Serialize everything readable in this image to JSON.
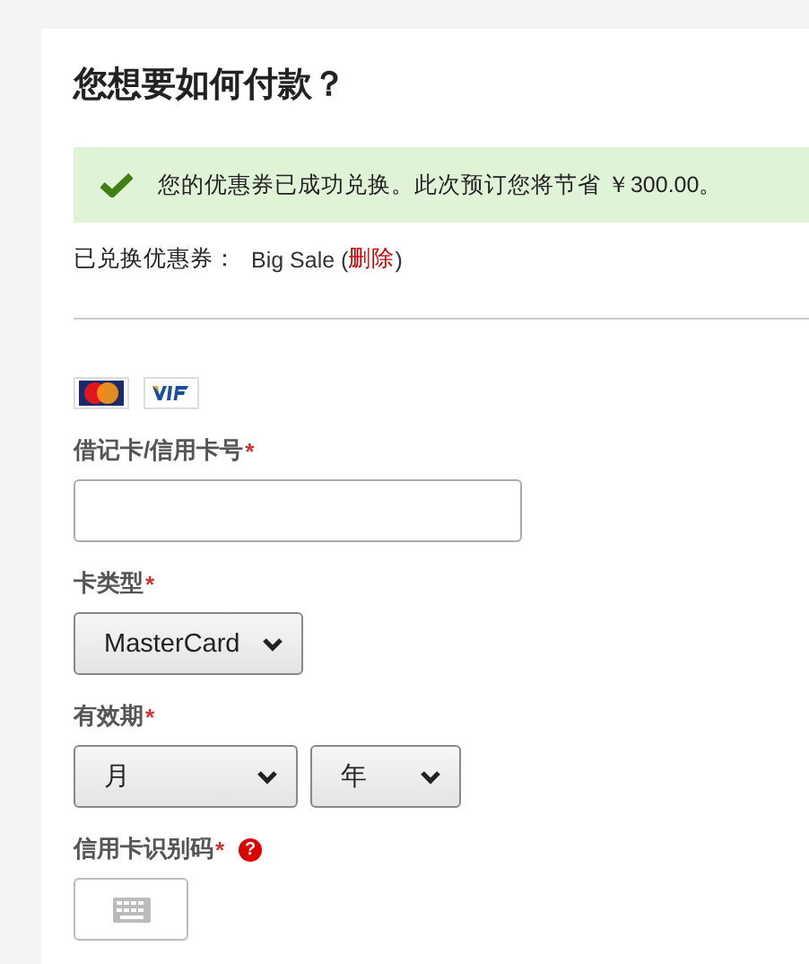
{
  "title": "您想要如何付款？",
  "success_banner": {
    "message": "您的优惠券已成功兑换。此次预订您将节省 ￥300.00。"
  },
  "coupon": {
    "label": "已兑换优惠券：",
    "name": "Big Sale",
    "open_paren": "(",
    "remove_link": "删除",
    "close_paren": ")"
  },
  "card_logos": [
    {
      "kind": "mastercard"
    },
    {
      "kind": "visa"
    }
  ],
  "card_number": {
    "label": "借记卡/信用卡号",
    "required_mark": "*"
  },
  "card_type": {
    "label": "卡类型",
    "required_mark": "*",
    "value": "MasterCard"
  },
  "expiry": {
    "label": "有效期",
    "required_mark": "*",
    "month": "月",
    "year": "年"
  },
  "cvv": {
    "label": "信用卡识别码",
    "required_mark": "*",
    "help": "?"
  }
}
